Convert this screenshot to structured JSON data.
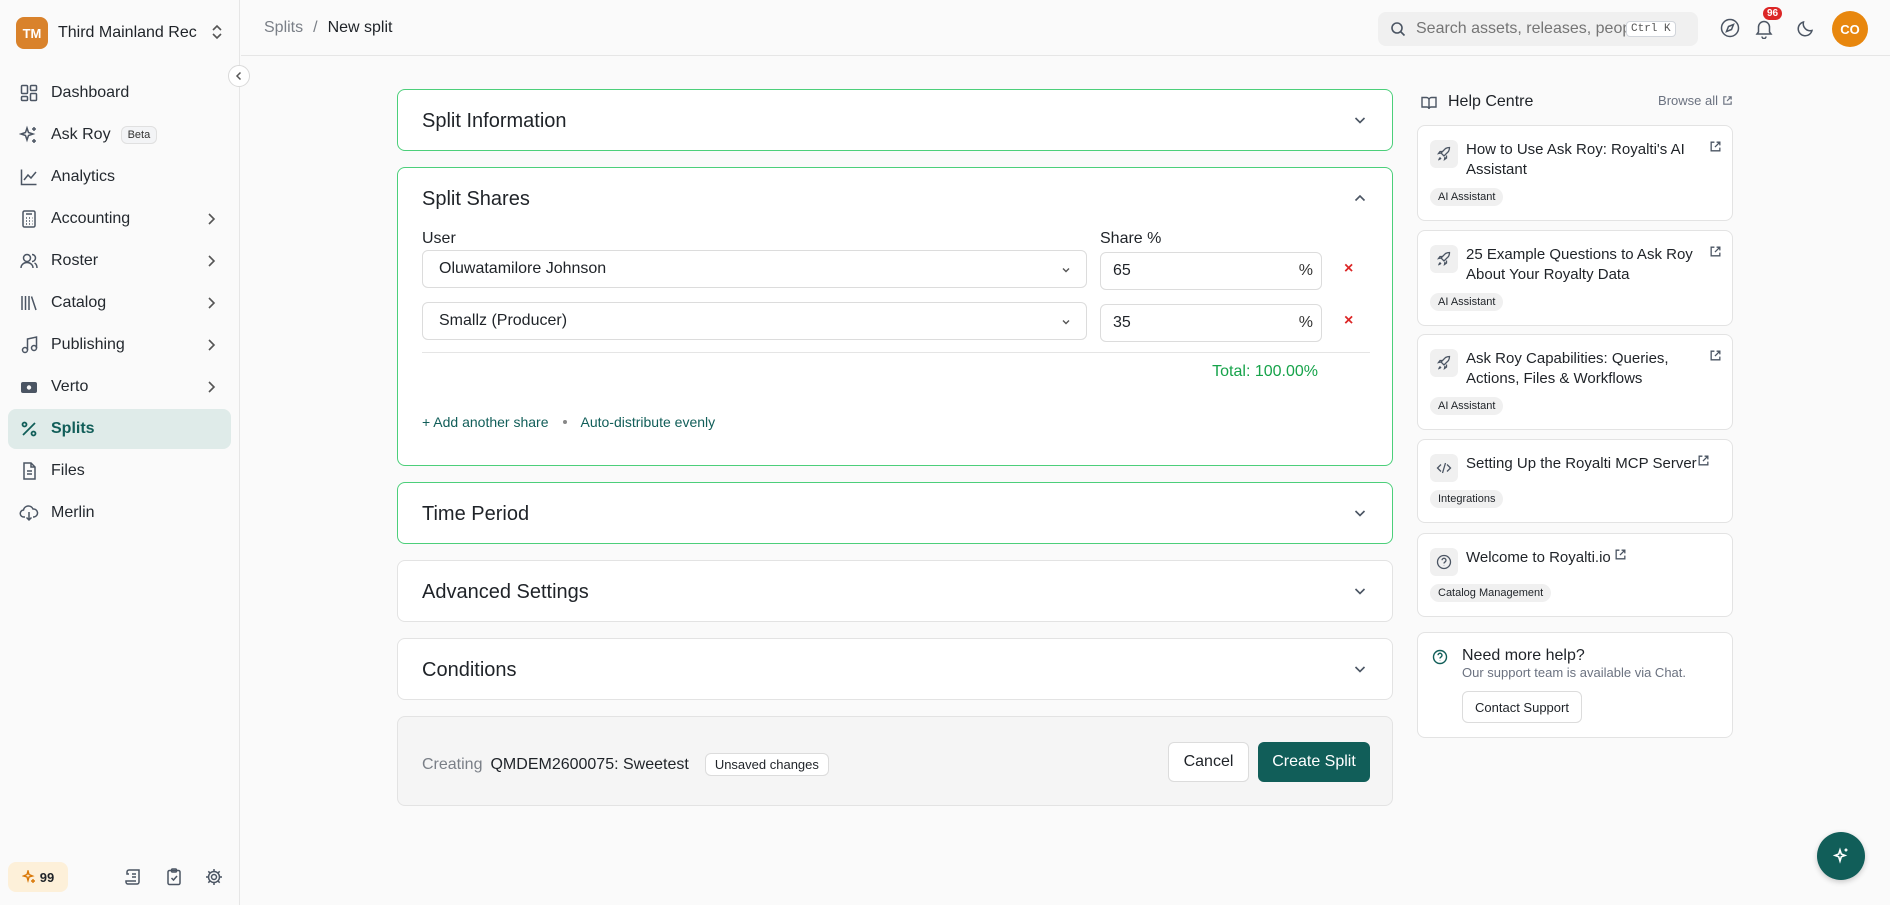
{
  "org": {
    "initials": "TM",
    "name": "Third Mainland Rec..."
  },
  "nav": [
    {
      "label": "Dashboard",
      "icon": "dashboard-icon"
    },
    {
      "label": "Ask Roy",
      "icon": "sparkle-icon",
      "badge": "Beta"
    },
    {
      "label": "Analytics",
      "icon": "chart-line-icon"
    },
    {
      "label": "Accounting",
      "icon": "calculator-icon",
      "expandable": true
    },
    {
      "label": "Roster",
      "icon": "users-icon",
      "expandable": true
    },
    {
      "label": "Catalog",
      "icon": "library-icon",
      "expandable": true
    },
    {
      "label": "Publishing",
      "icon": "music-note-icon",
      "expandable": true
    },
    {
      "label": "Verto",
      "icon": "wallet-icon",
      "expandable": true
    },
    {
      "label": "Splits",
      "icon": "percent-icon",
      "active": true
    },
    {
      "label": "Files",
      "icon": "file-icon"
    },
    {
      "label": "Merlin",
      "icon": "cloud-download-icon"
    }
  ],
  "sidebar_footer": {
    "credits": "99"
  },
  "breadcrumb": {
    "parent": "Splits",
    "separator": "/",
    "current": "New split"
  },
  "topbar": {
    "search_placeholder": "Search assets, releases, people...",
    "shortcut": "Ctrl K",
    "notification_count": "96",
    "user_initials": "CO"
  },
  "sections": {
    "info": {
      "title": "Split Information"
    },
    "shares": {
      "title": "Split Shares",
      "user_label": "User",
      "share_label": "Share %",
      "rows": [
        {
          "user": "Oluwatamilore Johnson",
          "share": "65"
        },
        {
          "user": "Smallz (Producer)",
          "share": "35"
        }
      ],
      "percent_sign": "%",
      "remove_symbol": "×",
      "total": "Total: 100.00%",
      "add_link": "+ Add another share",
      "distribute_link": "Auto-distribute evenly"
    },
    "time": {
      "title": "Time Period"
    },
    "advanced": {
      "title": "Advanced Settings"
    },
    "conditions": {
      "title": "Conditions"
    }
  },
  "footer": {
    "creating_label": "Creating",
    "release": "QMDEM2600075: Sweetest",
    "unsaved": "Unsaved changes",
    "cancel": "Cancel",
    "create": "Create Split"
  },
  "help": {
    "title": "Help Centre",
    "browse": "Browse all",
    "articles": [
      {
        "title": "How to Use Ask Roy: Royalti's AI Assistant",
        "tag": "AI Assistant",
        "icon": "rocket-icon"
      },
      {
        "title": "25 Example Questions to Ask Roy About Your Royalty Data",
        "tag": "AI Assistant",
        "icon": "rocket-icon"
      },
      {
        "title": "Ask Roy Capabilities: Queries, Actions, Files & Workflows",
        "tag": "AI Assistant",
        "icon": "rocket-icon"
      },
      {
        "title": "Setting Up the Royalti MCP Server",
        "tag": "Integrations",
        "icon": "code-icon"
      },
      {
        "title": "Welcome to Royalti.io",
        "tag": "Catalog Management",
        "icon": "help-circle-icon"
      }
    ],
    "support": {
      "title": "Need more help?",
      "desc": "Our support team is available via Chat.",
      "button": "Contact Support"
    }
  },
  "colors": {
    "accent": "#115e59",
    "success": "#16a34a",
    "danger": "#dc2626",
    "highlight_border": "#4ccf7a"
  }
}
